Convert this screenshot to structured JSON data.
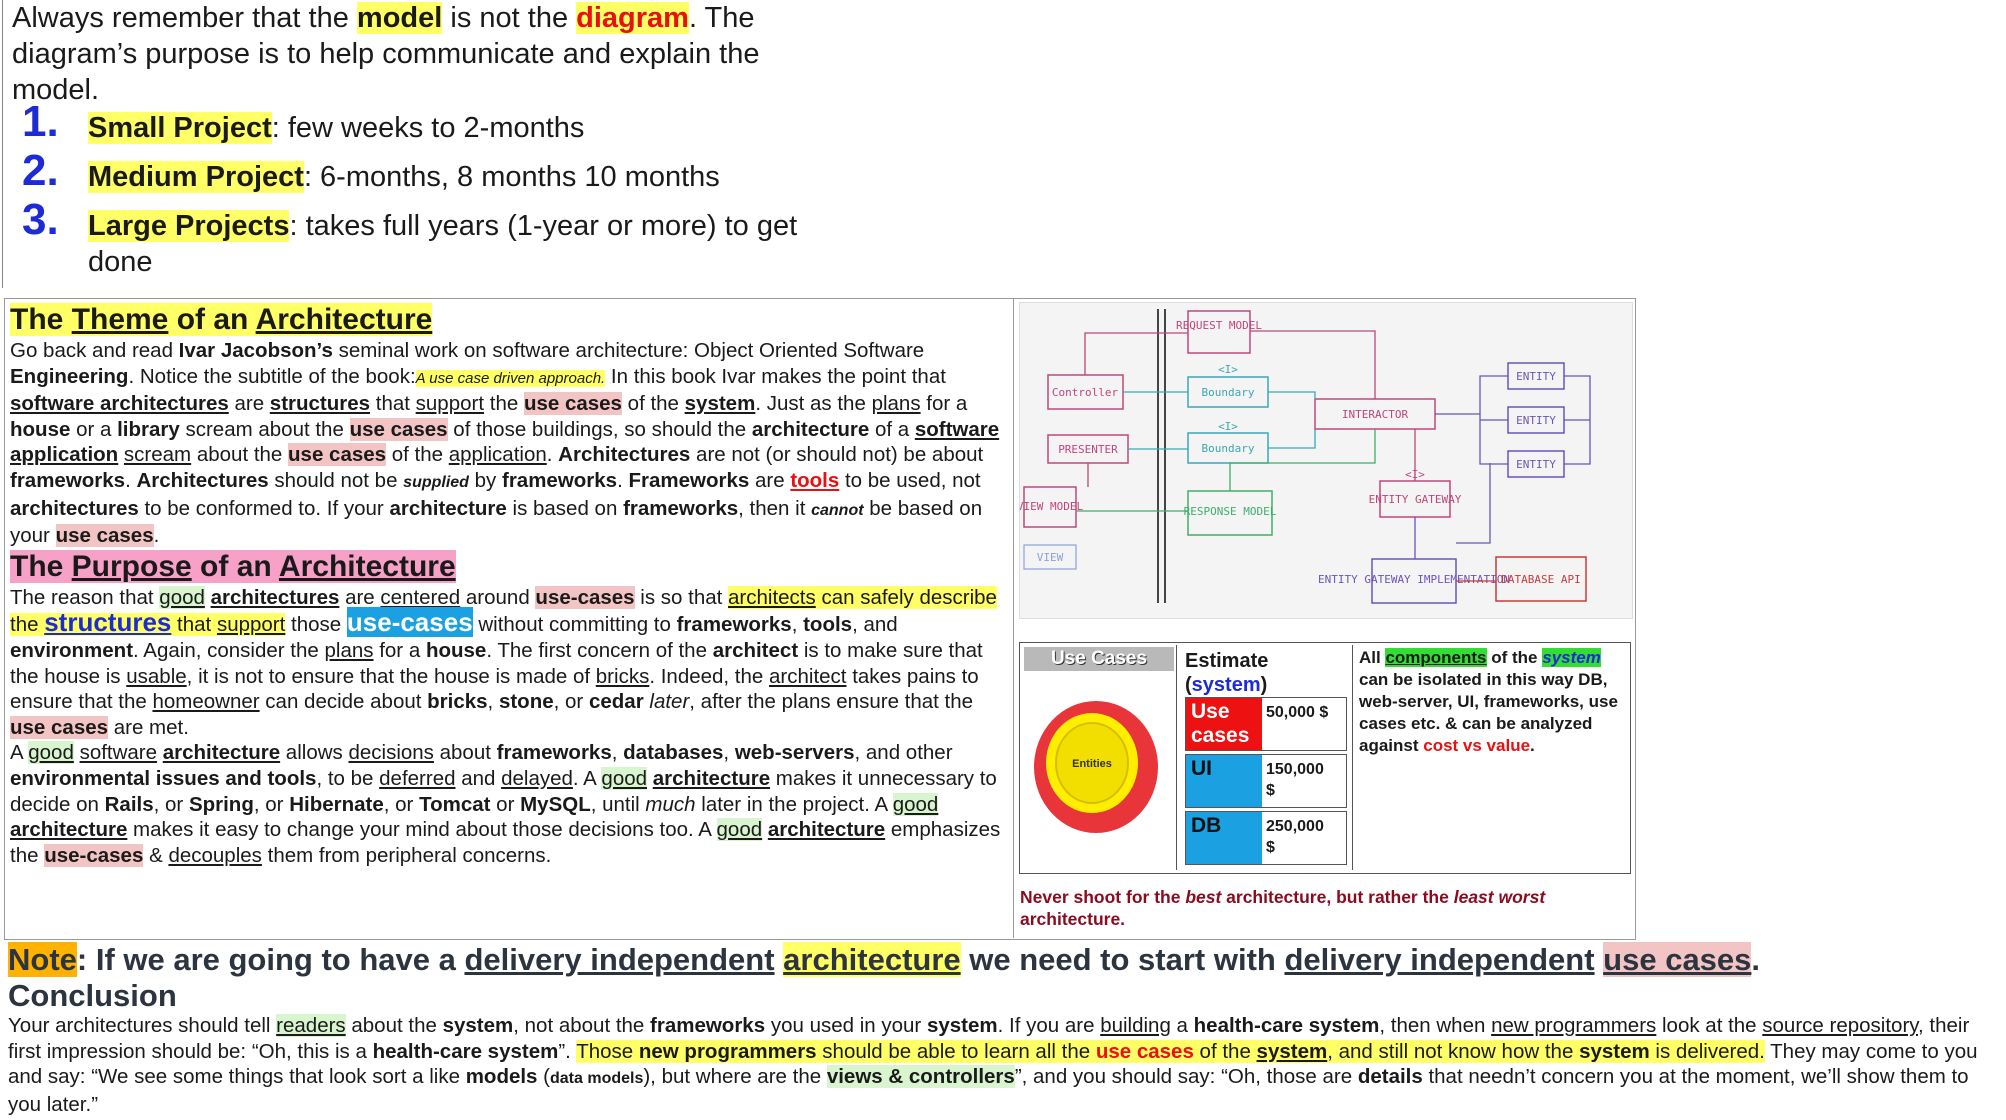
{
  "intro": {
    "p1_a": "Always remember that the ",
    "p1_model": "model",
    "p1_b": " is not the ",
    "p1_diagram": "diagram",
    "p1_c": ". The diagram’s purpose is to help communicate and explain the model.",
    "items": [
      {
        "num": "1.",
        "label": "Small Project",
        "text": ": few weeks to 2-months"
      },
      {
        "num": "2.",
        "label": "Medium Project",
        "text": ": 6-months, 8 months 10 months"
      },
      {
        "num": "3.",
        "label": "Large Projects",
        "text": ": takes full years (1-year or more) to get done"
      }
    ]
  },
  "theme": {
    "h_the": "The ",
    "h_theme": "Theme",
    "h_of": " of an ",
    "h_arch": "Architecture",
    "s1": "Go back and read ",
    "ivar": "Ivar Jacobson’s",
    "s2": " seminal work on software architecture: Object Oriented Software ",
    "eng": "Engineering",
    "s3": ". Notice the subtitle of the book:",
    "subtitle": "A use case driven approach.",
    "s4": " In this book Ivar makes the point that ",
    "sw_arch": "software architectures",
    "s5": " are ",
    "structures": "structures",
    "s6": " that ",
    "support": "support",
    "s7": " the ",
    "use_cases": "use cases",
    "s8": " of the ",
    "system": "system",
    "s9": ". Just as the ",
    "plans": "plans",
    "s10": " for a ",
    "house": "house",
    "s11": " or a ",
    "library": "library",
    "s12": " scream about the ",
    "s13": " of those buildings, so should the ",
    "architecture": "architecture",
    "s14": " of a ",
    "sw_app": "software application",
    "s15": " ",
    "scream": "scream",
    "s16": " about the ",
    "s17": " of the ",
    "application": "application",
    "s18": ". ",
    "architectures": "Architectures",
    "s19": " are not (or should not) be about ",
    "frameworks": "frameworks",
    "s20": ". ",
    "s21": " should not be ",
    "supplied": "supplied",
    "s22": " by ",
    "s23": ". ",
    "frameworks_cap": "Frameworks",
    "s24": " are ",
    "tools": "tools",
    "s25": " to be used, not ",
    "architectures_lc": "architectures",
    "s26": " to be conformed to. If your ",
    "s27": " is based on ",
    "s28": ", then it ",
    "cannot": "cannot",
    "s29": " be based on your ",
    "s30": "."
  },
  "purpose": {
    "h_the": "The ",
    "h_purpose": "Purpose",
    "h_of": " of an ",
    "h_arch": "Architecture",
    "t1": "The reason that ",
    "good": "good",
    "t2": " ",
    "architectures": "architectures",
    "t3": " are ",
    "centered": "centered",
    "t4": " around ",
    "use_cases_dash": "use-cases",
    "t5": " is so that ",
    "architects": "architects",
    "t6": " can safely describe the ",
    "structures": "structures",
    "t7": " that ",
    "support": "support",
    "t8": " those ",
    "t9": " without committing to ",
    "frameworks": "frameworks",
    "t10": ", ",
    "tools": "tools",
    "t11": ", and ",
    "environment": "environment",
    "t12": ". Again, consider the ",
    "plans": "plans",
    "t13": " for a ",
    "house": "house",
    "t14": ". The first concern of the ",
    "architect": "architect",
    "t15": " is to make sure that the house is ",
    "usable": "usable",
    "t16": ", it is not to ensure that the house is made of ",
    "bricks": "bricks",
    "t17": ". Indeed, the ",
    "architect_u": "architect",
    "t18": " takes pains to ensure that the ",
    "homeowner": "homeowner",
    "t19": " can decide about ",
    "bricks_b": "bricks",
    "t20": ", ",
    "stone": "stone",
    "t21": ", or ",
    "cedar": "cedar",
    "t22": " ",
    "later": "later",
    "t23": ", after the plans ensure that the ",
    "use_cases": "use cases",
    "t24": " are met.",
    "p2_a": "A ",
    "p2_good": "good",
    "p2_b": " ",
    "p2_software": "software",
    "p2_c": " ",
    "p2_arch": "architecture",
    "p2_d": " allows ",
    "decisions": "decisions",
    "p2_e": " about ",
    "frameworks2": "frameworks",
    "p2_f": ", ",
    "databases": "databases",
    "p2_g": ", ",
    "webservers": "web-servers",
    "p2_h": ", and other ",
    "env_issues": "environmental issues and tools",
    "p2_i": ", to be ",
    "deferred": "deferred",
    "p2_j": " and ",
    "delayed": "delayed",
    "p2_k": ". A ",
    "p2_good2": "good",
    "p2_l": " ",
    "p2_arch2": "architecture",
    "p2_m": " makes it unnecessary to decide on ",
    "rails": "Rails",
    "p2_n": ", or ",
    "spring": "Spring",
    "p2_o": ", or ",
    "hibernate": "Hibernate",
    "p2_p": ", or ",
    "tomcat": "Tomcat",
    "p2_q": " or ",
    "mysql": "MySQL",
    "p2_r": ", until ",
    "much": "much",
    "p2_s": " later in the project. A ",
    "p2_good3": "good",
    "p2_t": " ",
    "p2_arch3": "architecture",
    "p2_u": " makes it easy to change your mind about those decisions too. A ",
    "p2_good4": "good",
    "p2_v": " ",
    "p2_arch4": "architecture",
    "p2_w": " emphasizes the ",
    "p2_uc": "use-cases",
    "p2_x": " & ",
    "decouples": "decouples",
    "p2_y": " them from peripheral concerns."
  },
  "diagram": {
    "labels": [
      "REQUEST MODEL",
      "Controller",
      "Boundary",
      "INTERACTOR",
      "ENTITY",
      "ENTITY",
      "ENTITY",
      "PRESENTER",
      "Boundary",
      "ENTITY GATEWAY",
      "VIEW MODEL",
      "RESPONSE MODEL",
      "VIEW",
      "ENTITY GATEWAY IMPLEMENTATION",
      "DATABASE API",
      "<I>",
      "<I>",
      "<I>"
    ],
    "colors": {
      "pink": "#c0467a",
      "teal": "#3aa7b5",
      "green": "#3fae6a",
      "purple": "#6b55b8",
      "red": "#c93b3b"
    }
  },
  "usecases": {
    "title": "Use Cases",
    "center": "Entities",
    "estimate_a": "Estimate",
    "estimate_b": "(",
    "estimate_sys": "system",
    "estimate_c": ")",
    "rows": [
      {
        "label": "Use cases",
        "value": "50,000 $",
        "color": "#ee1111"
      },
      {
        "label": "UI",
        "value": "150,000$",
        "color": "#1ba1e2"
      },
      {
        "label": "DB",
        "value": "250,000$",
        "color": "#1ba1e2"
      }
    ],
    "comp_a": "All ",
    "components": "components",
    "comp_b": " of the ",
    "comp_system": "system",
    "comp_c": " can be isolated in this way DB, web-server, UI, frameworks, use cases etc. & can be analyzed against ",
    "cost": "cost vs value",
    "comp_d": "."
  },
  "never": {
    "a": "Never shoot for the ",
    "best": "best",
    "b": " architecture, but rather the ",
    "least": "least worst",
    "c": " architecture."
  },
  "note": {
    "note": "Note",
    "a": ": If we are going to have a ",
    "dia": "delivery independent",
    "b": " ",
    "arch": "architecture",
    "c": " we need to start with ",
    "di2": "delivery independent",
    "d": " ",
    "uc": "use cases",
    "e": "."
  },
  "conclusion": {
    "title": "Conclusion",
    "a": "Your architectures should tell ",
    "readers": "readers",
    "b": " about the ",
    "system": "system",
    "c": ", not about the ",
    "frameworks": "frameworks",
    "d": " you used in your ",
    "system2": "system",
    "e": ". If you are ",
    "building": "building",
    "f": " a ",
    "hcs": "health-care system",
    "g": ", then when ",
    "new_prog": "new programmers",
    "h": " look at the ",
    "source_repo": "source repository",
    "i": ", their first impression should be: “Oh, this is a ",
    "hcs2": "health-care system",
    "j": "”. ",
    "y1": "Those ",
    "new_prog2": "new programmers",
    "y2": " should be able to learn all the ",
    "use_cases": "use cases",
    "y3": " of the ",
    "system3": "system",
    "y4": ", and still not know how the ",
    "system4": "system",
    "y5": " is delivered.",
    "k": " They may come to you and say: “We see some things that look sort a like ",
    "models": "models",
    "l": " (",
    "data_models": "data models",
    "m": "), but where are the ",
    "views": "views & controllers",
    "n": "”, and you should say: “Oh, those are ",
    "details": "details",
    "o": " that needn’t concern you at the moment, we’ll show them to you later.”"
  }
}
